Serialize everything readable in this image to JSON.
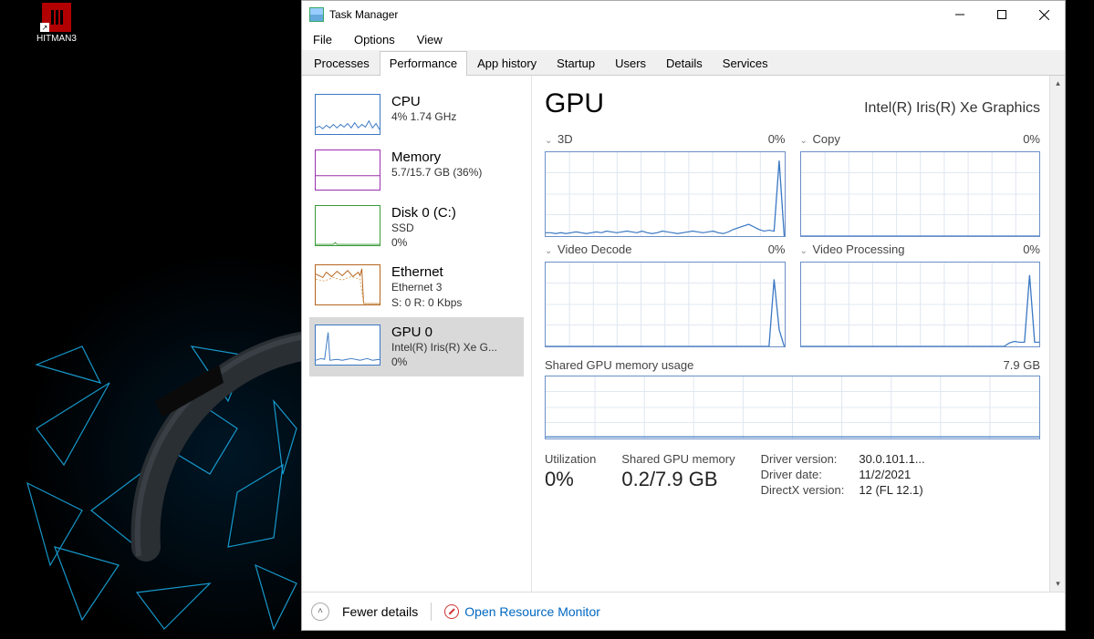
{
  "desktop": {
    "icon_label": "HITMAN3"
  },
  "window": {
    "title": "Task Manager"
  },
  "menu": {
    "file": "File",
    "options": "Options",
    "view": "View"
  },
  "tabs": {
    "processes": "Processes",
    "performance": "Performance",
    "app_history": "App history",
    "startup": "Startup",
    "users": "Users",
    "details": "Details",
    "services": "Services"
  },
  "sidebar": {
    "cpu": {
      "title": "CPU",
      "sub": "4%  1.74 GHz"
    },
    "memory": {
      "title": "Memory",
      "sub": "5.7/15.7 GB (36%)"
    },
    "disk": {
      "title": "Disk 0 (C:)",
      "sub1": "SSD",
      "sub2": "0%"
    },
    "ethernet": {
      "title": "Ethernet",
      "sub1": "Ethernet 3",
      "sub2": "S: 0 R: 0 Kbps"
    },
    "gpu": {
      "title": "GPU 0",
      "sub1": "Intel(R) Iris(R) Xe G...",
      "sub2": "0%"
    }
  },
  "gpu": {
    "title": "GPU",
    "name": "Intel(R) Iris(R) Xe Graphics",
    "charts": {
      "c1": {
        "label": "3D",
        "pct": "0%"
      },
      "c2": {
        "label": "Copy",
        "pct": "0%"
      },
      "c3": {
        "label": "Video Decode",
        "pct": "0%"
      },
      "c4": {
        "label": "Video Processing",
        "pct": "0%"
      }
    },
    "shared_mem": {
      "label": "Shared GPU memory usage",
      "max": "7.9 GB"
    }
  },
  "stats": {
    "util_label": "Utilization",
    "util_value": "0%",
    "shared_label": "Shared GPU memory",
    "shared_value": "0.2/7.9 GB",
    "driver_version_k": "Driver version:",
    "driver_version_v": "30.0.101.1...",
    "driver_date_k": "Driver date:",
    "driver_date_v": "11/2/2021",
    "directx_k": "DirectX version:",
    "directx_v": "12 (FL 12.1)"
  },
  "footer": {
    "fewer": "Fewer details",
    "resmon": "Open Resource Monitor"
  },
  "chart_data": [
    {
      "type": "line",
      "title": "3D",
      "ylim": [
        0,
        100
      ],
      "values": [
        4,
        4,
        3,
        4,
        3,
        4,
        5,
        4,
        3,
        4,
        5,
        4,
        6,
        5,
        4,
        5,
        6,
        5,
        4,
        6,
        4,
        3,
        4,
        6,
        5,
        4,
        3,
        4,
        5,
        6,
        5,
        4,
        5,
        6,
        4,
        3,
        5,
        8,
        10,
        12,
        14,
        11,
        8,
        6,
        7,
        6,
        90,
        0
      ]
    },
    {
      "type": "line",
      "title": "Copy",
      "ylim": [
        0,
        100
      ],
      "values": [
        0,
        0,
        0,
        0,
        0,
        0,
        0,
        0,
        0,
        0,
        0,
        0,
        0,
        0,
        0,
        0,
        0,
        0,
        0,
        0,
        0,
        0,
        0,
        0,
        0,
        0,
        0,
        0,
        0,
        0,
        0,
        0,
        0,
        0,
        0,
        0,
        0,
        0,
        0,
        0,
        0,
        0,
        0,
        0,
        0,
        0,
        0,
        0
      ]
    },
    {
      "type": "line",
      "title": "Video Decode",
      "ylim": [
        0,
        100
      ],
      "values": [
        0,
        0,
        0,
        0,
        0,
        0,
        0,
        0,
        0,
        0,
        0,
        0,
        0,
        0,
        0,
        0,
        0,
        0,
        0,
        0,
        0,
        0,
        0,
        0,
        0,
        0,
        0,
        0,
        0,
        0,
        0,
        0,
        0,
        0,
        0,
        0,
        0,
        0,
        0,
        0,
        0,
        0,
        0,
        0,
        0,
        80,
        20,
        0
      ]
    },
    {
      "type": "line",
      "title": "Video Processing",
      "ylim": [
        0,
        100
      ],
      "values": [
        0,
        0,
        0,
        0,
        0,
        0,
        0,
        0,
        0,
        0,
        0,
        0,
        0,
        0,
        0,
        0,
        0,
        0,
        0,
        0,
        0,
        0,
        0,
        0,
        0,
        0,
        0,
        0,
        0,
        0,
        0,
        0,
        0,
        0,
        0,
        0,
        0,
        0,
        0,
        0,
        0,
        4,
        6,
        5,
        5,
        85,
        5,
        5
      ]
    },
    {
      "type": "line",
      "title": "Shared GPU memory usage",
      "ylabel": "GB",
      "ylim": [
        0,
        7.9
      ],
      "values": [
        0.2,
        0.2,
        0.2,
        0.2,
        0.2,
        0.2,
        0.2,
        0.2,
        0.2,
        0.2,
        0.2,
        0.2,
        0.2,
        0.2,
        0.2,
        0.2,
        0.2,
        0.2,
        0.2,
        0.2,
        0.2,
        0.2,
        0.2,
        0.2,
        0.2,
        0.2,
        0.2,
        0.2,
        0.2,
        0.2,
        0.2,
        0.2,
        0.2,
        0.2,
        0.2,
        0.2,
        0.2,
        0.2,
        0.2,
        0.2,
        0.2,
        0.2,
        0.2,
        0.2,
        0.2,
        0.2,
        0.2,
        0.2
      ]
    }
  ]
}
